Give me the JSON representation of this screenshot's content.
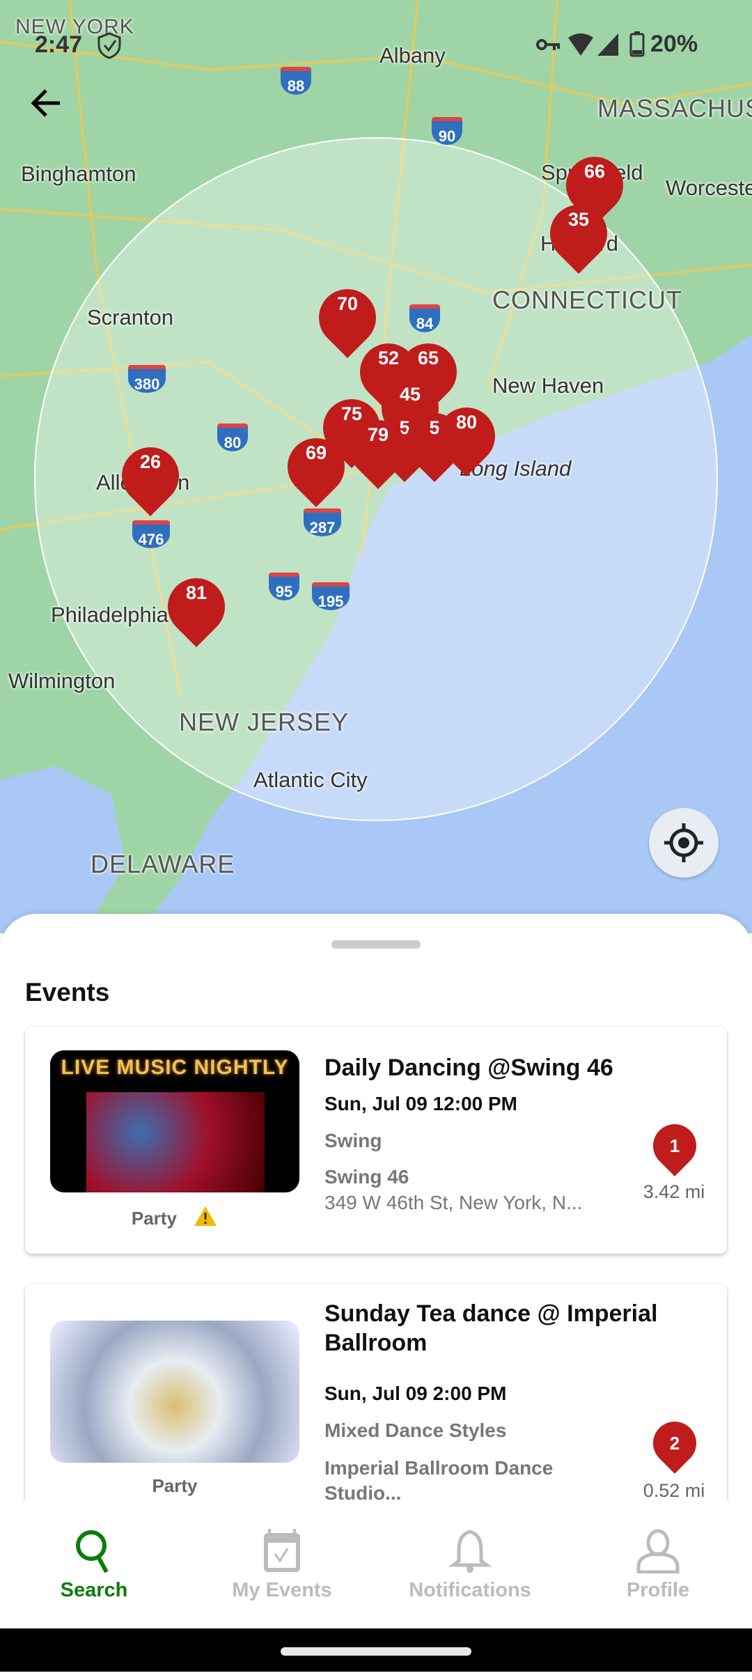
{
  "status_bar": {
    "time": "2:47",
    "battery": "20%",
    "icons": [
      "shield-check-icon",
      "vpn-key-icon",
      "wifi-icon",
      "signal-icon",
      "battery-icon"
    ]
  },
  "map": {
    "labels": {
      "new_york": "NEW YORK",
      "albany": "Albany",
      "massachusetts": "MASSACHUS",
      "binghamton": "Binghamton",
      "springfield": "Springfield",
      "worcester": "Worceste",
      "hartford": "Hartford",
      "connecticut": "CONNECTICUT",
      "scranton": "Scranton",
      "new_haven": "New Haven",
      "long_island": "Long Island",
      "allentown": "Allentown",
      "philadelphia": "Philadelphia",
      "wilmington": "Wilmington",
      "new_jersey": "NEW JERSEY",
      "atlantic_city": "Atlantic City",
      "delaware": "DELAWARE"
    },
    "highways": [
      "88",
      "90",
      "84",
      "380",
      "80",
      "287",
      "476",
      "95",
      "195"
    ],
    "clusters": [
      "66",
      "35",
      "70",
      "52",
      "65",
      "45",
      "75",
      "5",
      "5",
      "80",
      "79",
      "69",
      "26",
      "81"
    ],
    "marker_color": "#c01c1c"
  },
  "sheet": {
    "title": "Events",
    "events": [
      {
        "image_text": "LIVE MUSIC NIGHTLY",
        "category": "Party",
        "warning": true,
        "title": "Daily Dancing @Swing 46",
        "date": "Sun, Jul 09  12:00 PM",
        "style": "Swing",
        "venue": "Swing 46",
        "address": "349 W 46th St, New York, N...",
        "marker": "1",
        "distance": "3.42 mi"
      },
      {
        "category": "Party",
        "warning": false,
        "title": "Sunday Tea dance @ Imperial Ballroom",
        "date": "Sun, Jul 09  2:00 PM",
        "style": "Mixed Dance Styles",
        "venue": "Imperial Ballroom Dance Studio...",
        "marker": "2",
        "distance": "0.52 mi"
      }
    ]
  },
  "nav": {
    "items": [
      {
        "label": "Search",
        "active": true
      },
      {
        "label": "My Events"
      },
      {
        "label": "Notifications"
      },
      {
        "label": "Profile"
      }
    ],
    "active_color": "#0a7d0a",
    "inactive_color": "#bbbbbb"
  }
}
